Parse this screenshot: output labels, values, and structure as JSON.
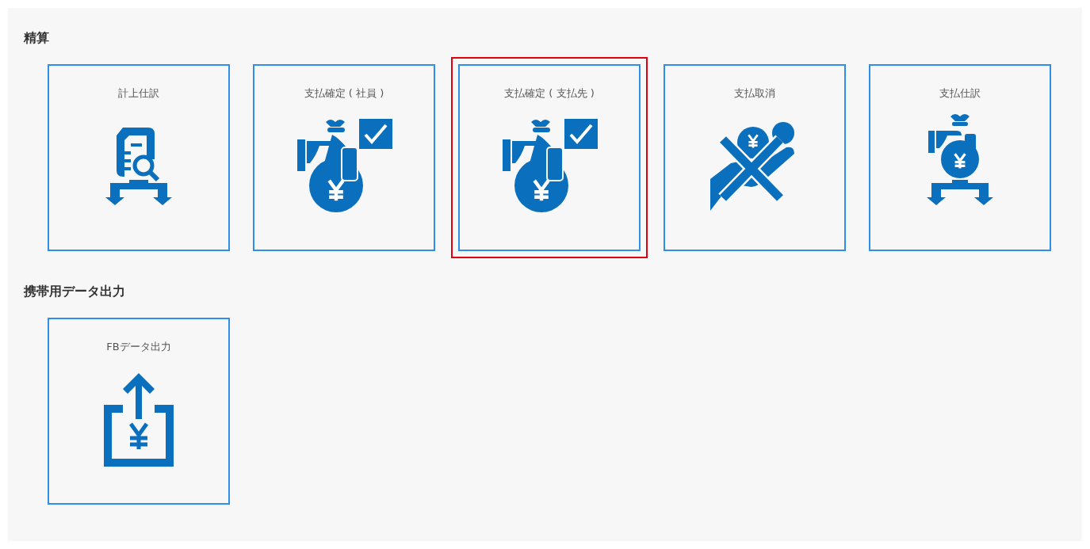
{
  "sections": [
    {
      "title": "精算",
      "tiles": [
        {
          "label": "計上仕訳",
          "kind": "document",
          "selected": false
        },
        {
          "label": "支払確定 ( 社員 )",
          "kind": "approve",
          "selected": false
        },
        {
          "label": "支払確定 ( 支払先 )",
          "kind": "approve",
          "selected": true
        },
        {
          "label": "支払取消",
          "kind": "cancel",
          "selected": false
        },
        {
          "label": "支払仕訳",
          "kind": "split",
          "selected": false
        }
      ]
    },
    {
      "title": "携帯用データ出力",
      "tiles": [
        {
          "label": "FBデータ出力",
          "kind": "export",
          "selected": false
        }
      ]
    }
  ]
}
